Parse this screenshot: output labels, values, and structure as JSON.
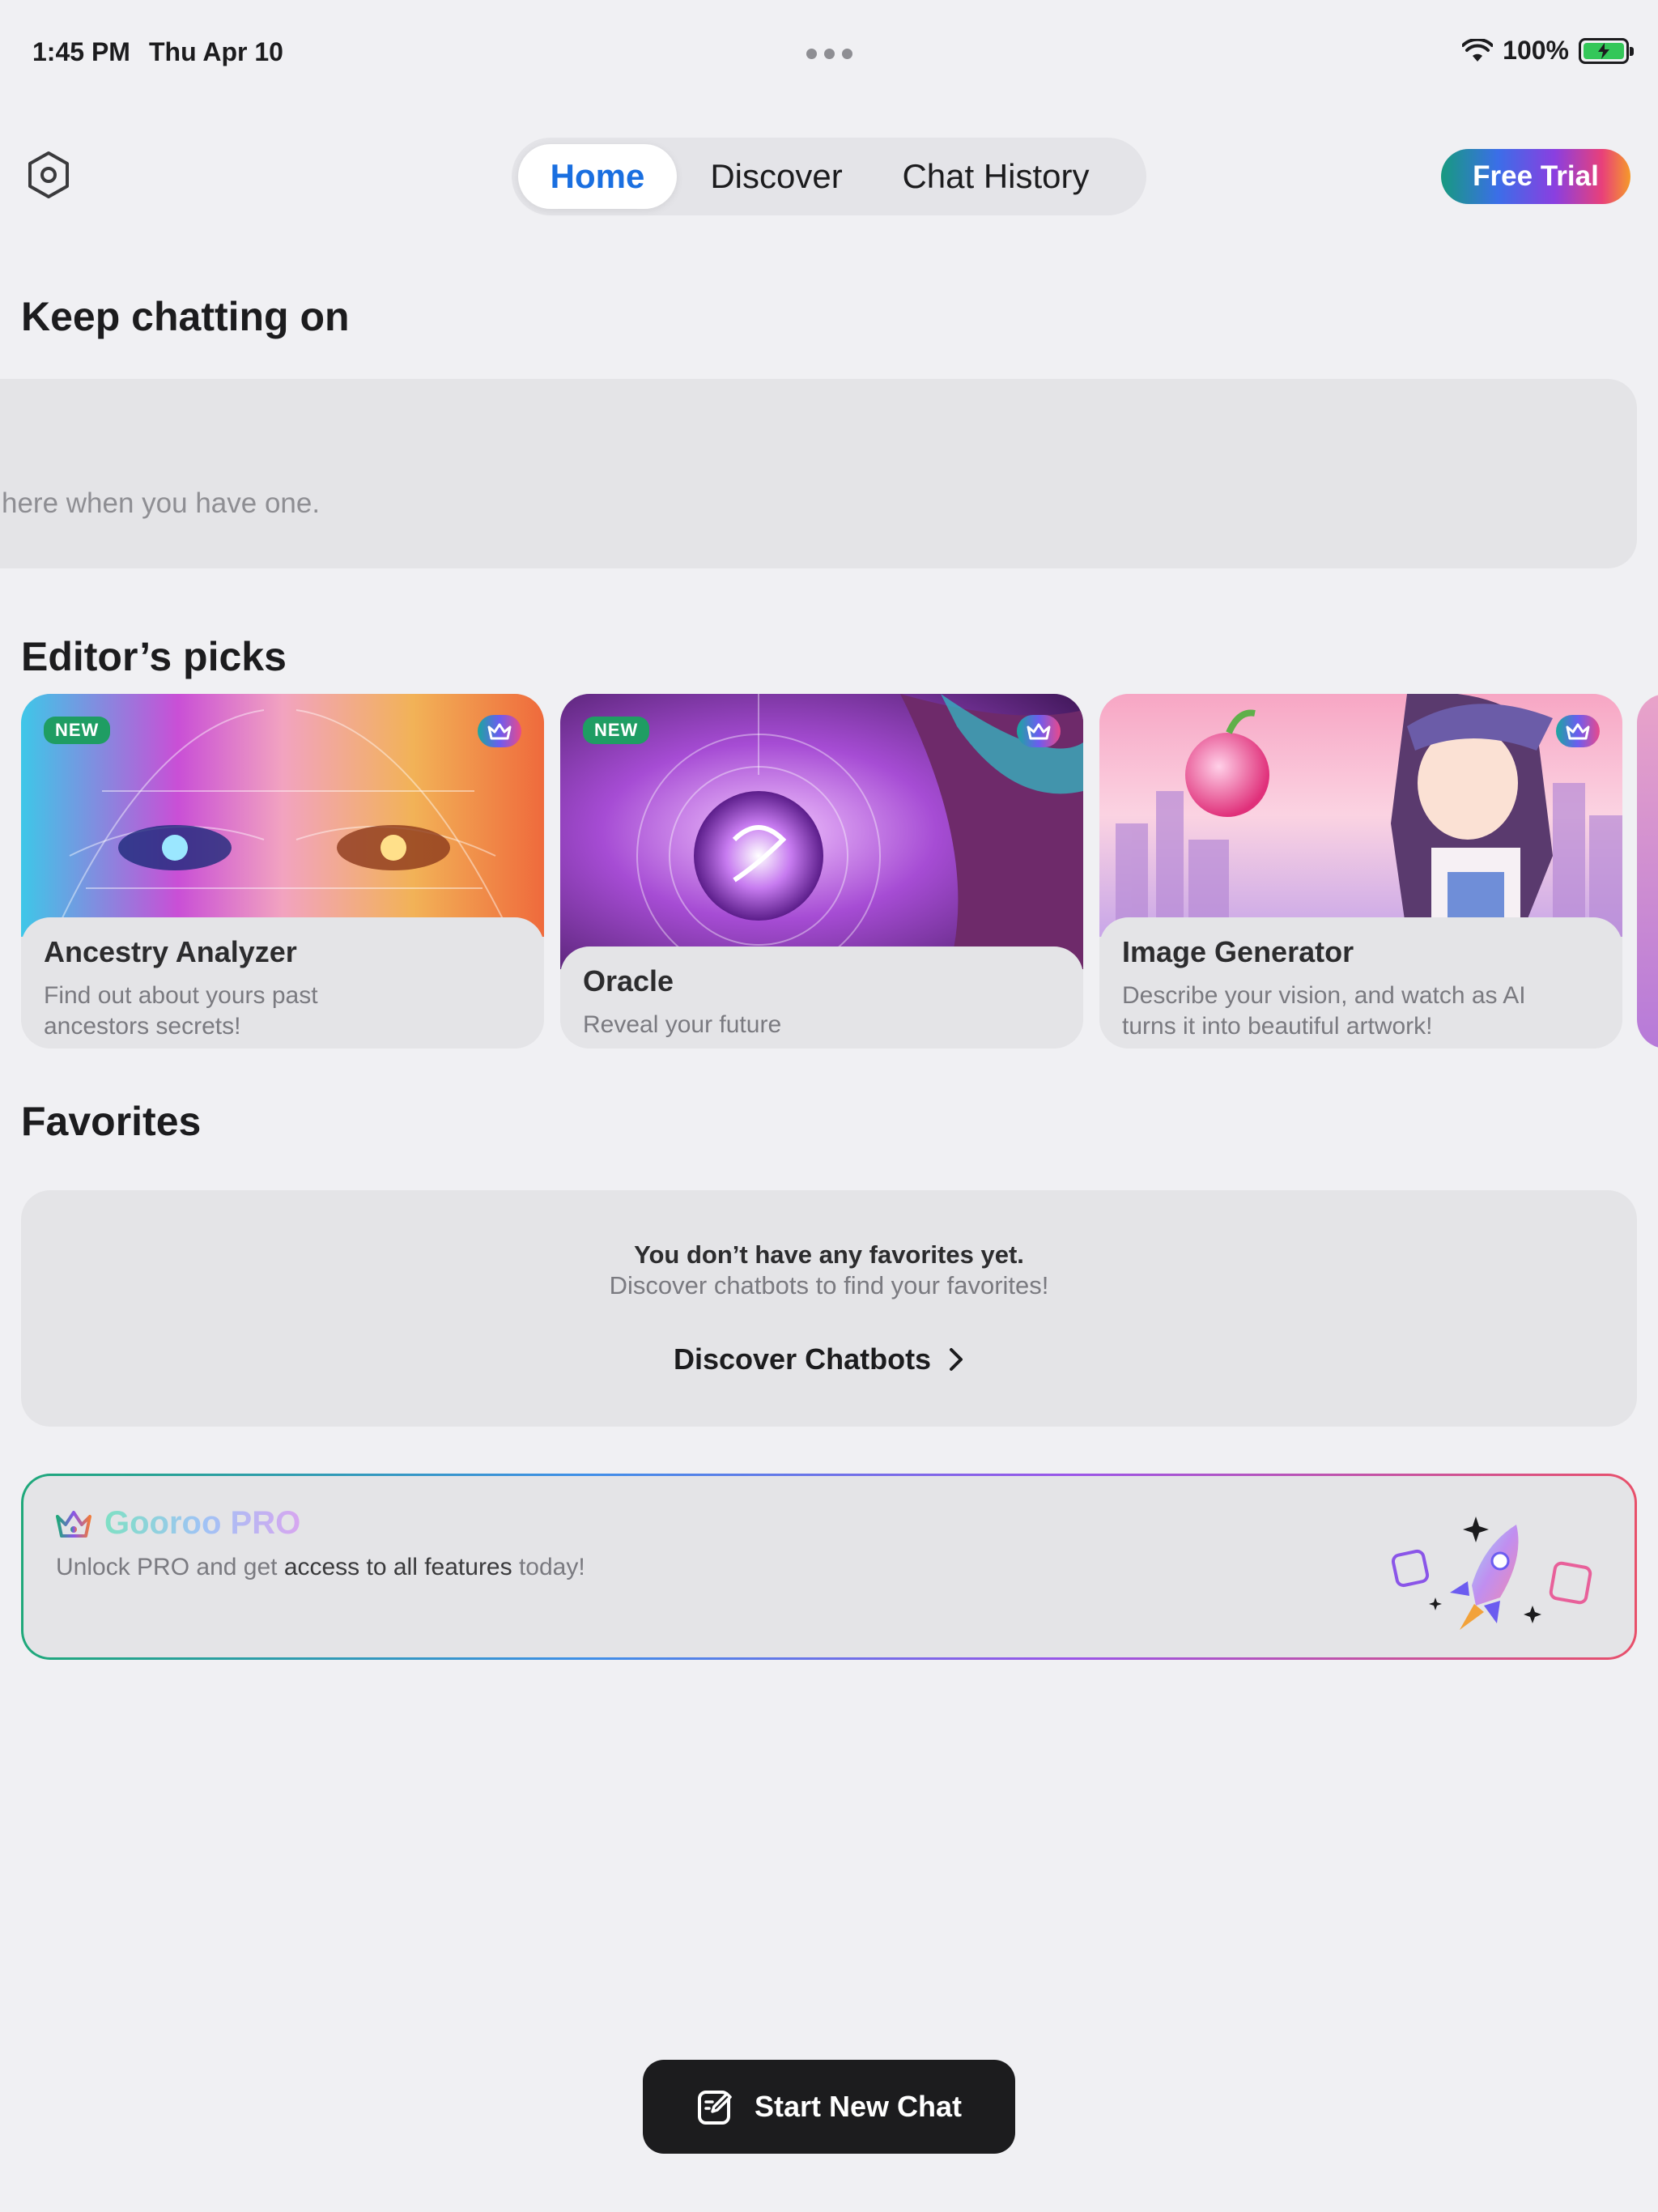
{
  "status_bar": {
    "time": "1:45 PM",
    "date": "Thu Apr 10",
    "battery": "100%"
  },
  "nav": {
    "tabs": [
      "Home",
      "Discover",
      "Chat History"
    ],
    "active_tab": "Home",
    "free_trial": "Free Trial"
  },
  "sections": {
    "keep_chatting": "Keep chatting on",
    "keep_chatting_empty": "here when you have one.",
    "editors_picks": "Editor’s picks",
    "favorites": "Favorites"
  },
  "picks": [
    {
      "badge": "NEW",
      "title": "Ancestry Analyzer",
      "desc_lines": [
        "Find out about yours past",
        "ancestors secrets!"
      ],
      "icon": "face-grid-art"
    },
    {
      "badge": "NEW",
      "title": "Oracle",
      "desc_lines": [
        "Reveal your future"
      ],
      "icon": "crystal-ball-art"
    },
    {
      "badge": "",
      "title": "Image Generator",
      "desc_lines": [
        "Describe your vision, and watch as AI",
        "turns it into beautiful artwork!"
      ],
      "icon": "anime-painter-art"
    }
  ],
  "favorites": {
    "empty_title": "You don’t have any favorites yet.",
    "empty_sub": "Discover chatbots to find your favorites!",
    "link": "Discover Chatbots"
  },
  "pro": {
    "title": "Gooroo PRO",
    "sub_pre": "Unlock PRO and get ",
    "sub_bold": "access to all features",
    "sub_post": " today!"
  },
  "start_button": "Start New Chat",
  "colors": {
    "accent": "#1a6fe0",
    "background": "#f0f0f3",
    "card": "#e4e4e7",
    "new_badge": "#1f9d63"
  }
}
